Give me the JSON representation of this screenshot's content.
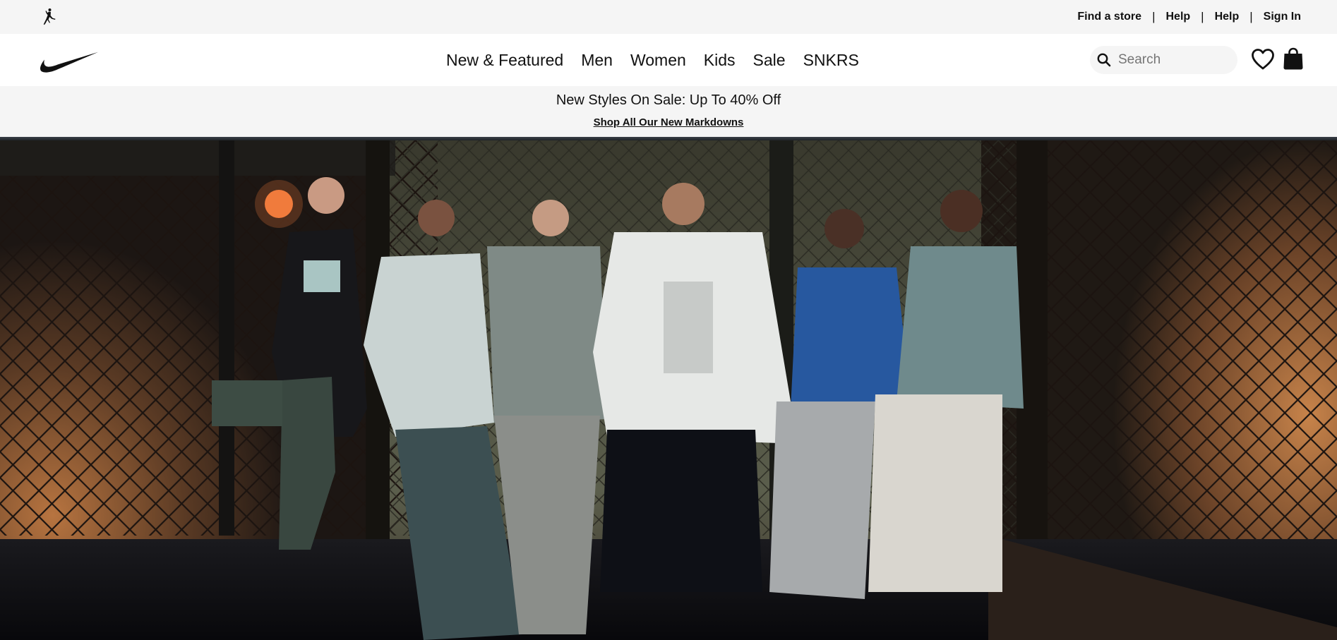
{
  "utility_bar": {
    "links": [
      "Find a store",
      "Help",
      "Help",
      "Sign In"
    ],
    "separator": "|"
  },
  "nav": {
    "items": [
      "New & Featured",
      "Men",
      "Women",
      "Kids",
      "Sale",
      "SNKRS"
    ]
  },
  "search": {
    "placeholder": "Search",
    "value": ""
  },
  "promo": {
    "title": "New Styles On Sale: Up To 40% Off",
    "link": "Shop All Our New Markdowns"
  },
  "icons": {
    "brand_logo": "nike-swoosh-icon",
    "secondary_logo": "jordan-jumpman-icon",
    "search": "search-icon",
    "favorites": "heart-icon",
    "bag": "shopping-bag-icon"
  },
  "colors": {
    "utility_bg": "#f5f5f5",
    "text": "#111111",
    "placeholder": "#757575",
    "hero_glow": "#c07a40"
  }
}
